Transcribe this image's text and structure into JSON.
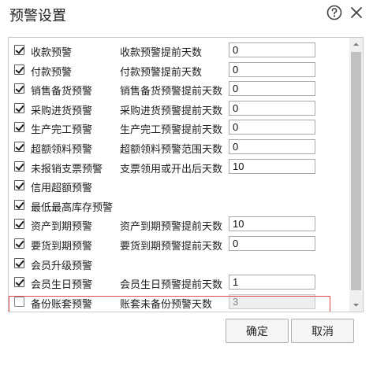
{
  "dialog": {
    "title": "预警设置",
    "icons": {
      "help": "help-circle-icon",
      "close": "close-icon"
    }
  },
  "rows": [
    {
      "checked": true,
      "name": "收款预警",
      "days_label": "收款预警提前天数",
      "value": "0"
    },
    {
      "checked": true,
      "name": "付款预警",
      "days_label": "付款预警提前天数",
      "value": "0"
    },
    {
      "checked": true,
      "name": "销售备货预警",
      "days_label": "销售备货预警提前天数",
      "value": "0"
    },
    {
      "checked": true,
      "name": "采购进货预警",
      "days_label": "采购进货预警提前天数",
      "value": "0"
    },
    {
      "checked": true,
      "name": "生产完工预警",
      "days_label": "生产完工预警提前天数",
      "value": "0"
    },
    {
      "checked": true,
      "name": "超额领料预警",
      "days_label": "超额领料预警范围天数",
      "value": "0"
    },
    {
      "checked": true,
      "name": "未报销支票预警",
      "days_label": "支票领用或开出后天数",
      "value": "10"
    },
    {
      "checked": true,
      "name": "信用超额预警"
    },
    {
      "checked": true,
      "name": "最低最高库存预警"
    },
    {
      "checked": true,
      "name": "资产到期预警",
      "days_label": "资产到期预警提前天数",
      "value": "10"
    },
    {
      "checked": true,
      "name": "要货到期预警",
      "days_label": "要货到期预警提前天数",
      "value": "0"
    },
    {
      "checked": true,
      "name": "会员升级预警"
    },
    {
      "checked": true,
      "name": "会员生日预警",
      "days_label": "会员生日预警提前天数",
      "value": "1"
    },
    {
      "checked": false,
      "name": "备份账套预警",
      "days_label": "账套未备份预警天数",
      "value": "3",
      "disabled": true
    }
  ],
  "buttons": {
    "ok": "确定",
    "cancel": "取消"
  },
  "colors": {
    "highlight_border": "#e04a4a",
    "scroll_thumb": "#c1c1c1"
  }
}
